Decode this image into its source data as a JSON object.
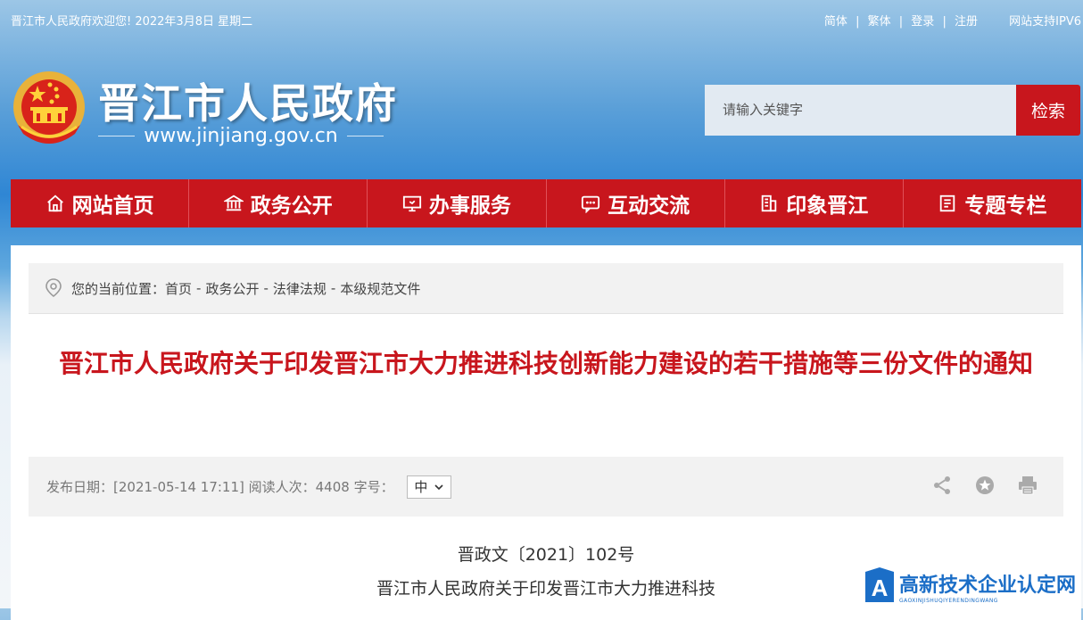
{
  "topbar": {
    "greeting": "晋江市人民政府欢迎您! 2022年3月8日 星期二",
    "links": [
      "简体",
      "繁体",
      "登录",
      "注册"
    ],
    "link_sep": "|",
    "ipv6": "网站支持IPV6"
  },
  "header": {
    "site_name": "晋江市人民政府",
    "site_url": "www.jinjiang.gov.cn"
  },
  "search": {
    "placeholder": "请输入关键字",
    "button": "检索"
  },
  "nav": [
    {
      "label": "网站首页",
      "icon": "home-icon"
    },
    {
      "label": "政务公开",
      "icon": "bank-icon"
    },
    {
      "label": "办事服务",
      "icon": "monitor-icon"
    },
    {
      "label": "互动交流",
      "icon": "chat-icon"
    },
    {
      "label": "印象晋江",
      "icon": "building-icon"
    },
    {
      "label": "专题专栏",
      "icon": "document-icon"
    }
  ],
  "breadcrumb": {
    "prefix": "您的当前位置：",
    "items": [
      "首页",
      "政务公开",
      "法律法规",
      "本级规范文件"
    ],
    "sep": "-"
  },
  "article": {
    "title": "晋江市人民政府关于印发晋江市大力推进科技创新能力建设的若干措施等三份文件的通知",
    "meta": "发布日期：[2021-05-14 17:11] 阅读人次：4408 字号：",
    "font_size_option": "中",
    "doc_number": "晋政文〔2021〕102号",
    "first_line": "晋江市人民政府关于印发晋江市大力推进科技"
  },
  "watermark": {
    "name": "高新技术企业认定网",
    "pinyin": "GAOXINJISHUQIYERENDINGWANG",
    "logo_letter": "A"
  },
  "colors": {
    "brand_red": "#c8161d",
    "watermark_blue": "#1b6ec7"
  }
}
